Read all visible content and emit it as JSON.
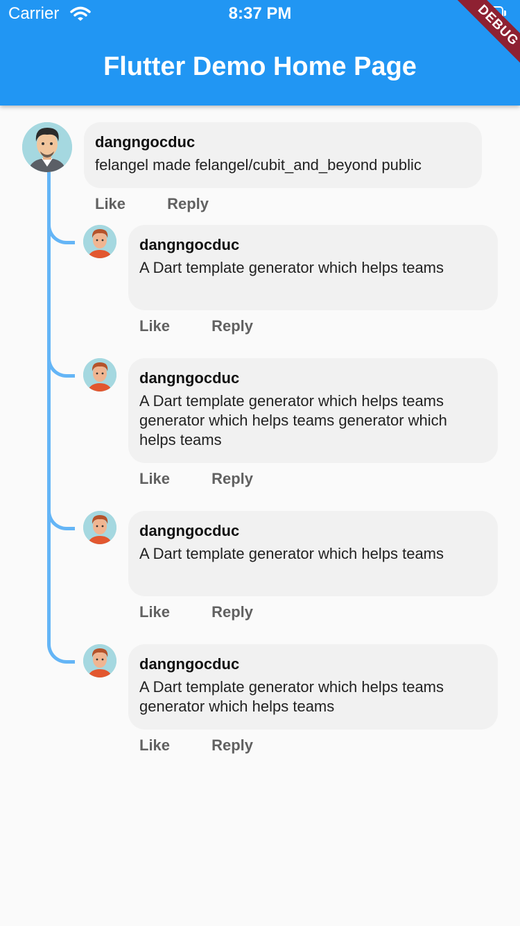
{
  "status_bar": {
    "carrier": "Carrier",
    "time": "8:37 PM"
  },
  "app_bar": {
    "title": "Flutter Demo Home Page",
    "debug_banner": "DEBUG"
  },
  "colors": {
    "app_bar": "#2196f3",
    "thread_line": "#64b5f6",
    "bubble": "#f1f1f1",
    "debug_banner": "#8e2132"
  },
  "root_comment": {
    "author": "dangngocduc",
    "text": "felangel made felangel/cubit_and_beyond public",
    "like_label": "Like",
    "reply_label": "Reply",
    "avatar_icon": "man-with-beard-avatar-icon"
  },
  "replies": [
    {
      "author": "dangngocduc",
      "text": "A Dart template generator which helps teams",
      "like_label": "Like",
      "reply_label": "Reply",
      "avatar_icon": "redhead-man-avatar-icon"
    },
    {
      "author": "dangngocduc",
      "text": "A Dart template generator which helps teams generator which helps teams generator which helps teams",
      "like_label": "Like",
      "reply_label": "Reply",
      "avatar_icon": "redhead-man-avatar-icon"
    },
    {
      "author": "dangngocduc",
      "text": "A Dart template generator which helps teams",
      "like_label": "Like",
      "reply_label": "Reply",
      "avatar_icon": "redhead-man-avatar-icon"
    },
    {
      "author": "dangngocduc",
      "text": "A Dart template generator which helps teams generator which helps teams",
      "like_label": "Like",
      "reply_label": "Reply",
      "avatar_icon": "redhead-man-avatar-icon"
    }
  ]
}
